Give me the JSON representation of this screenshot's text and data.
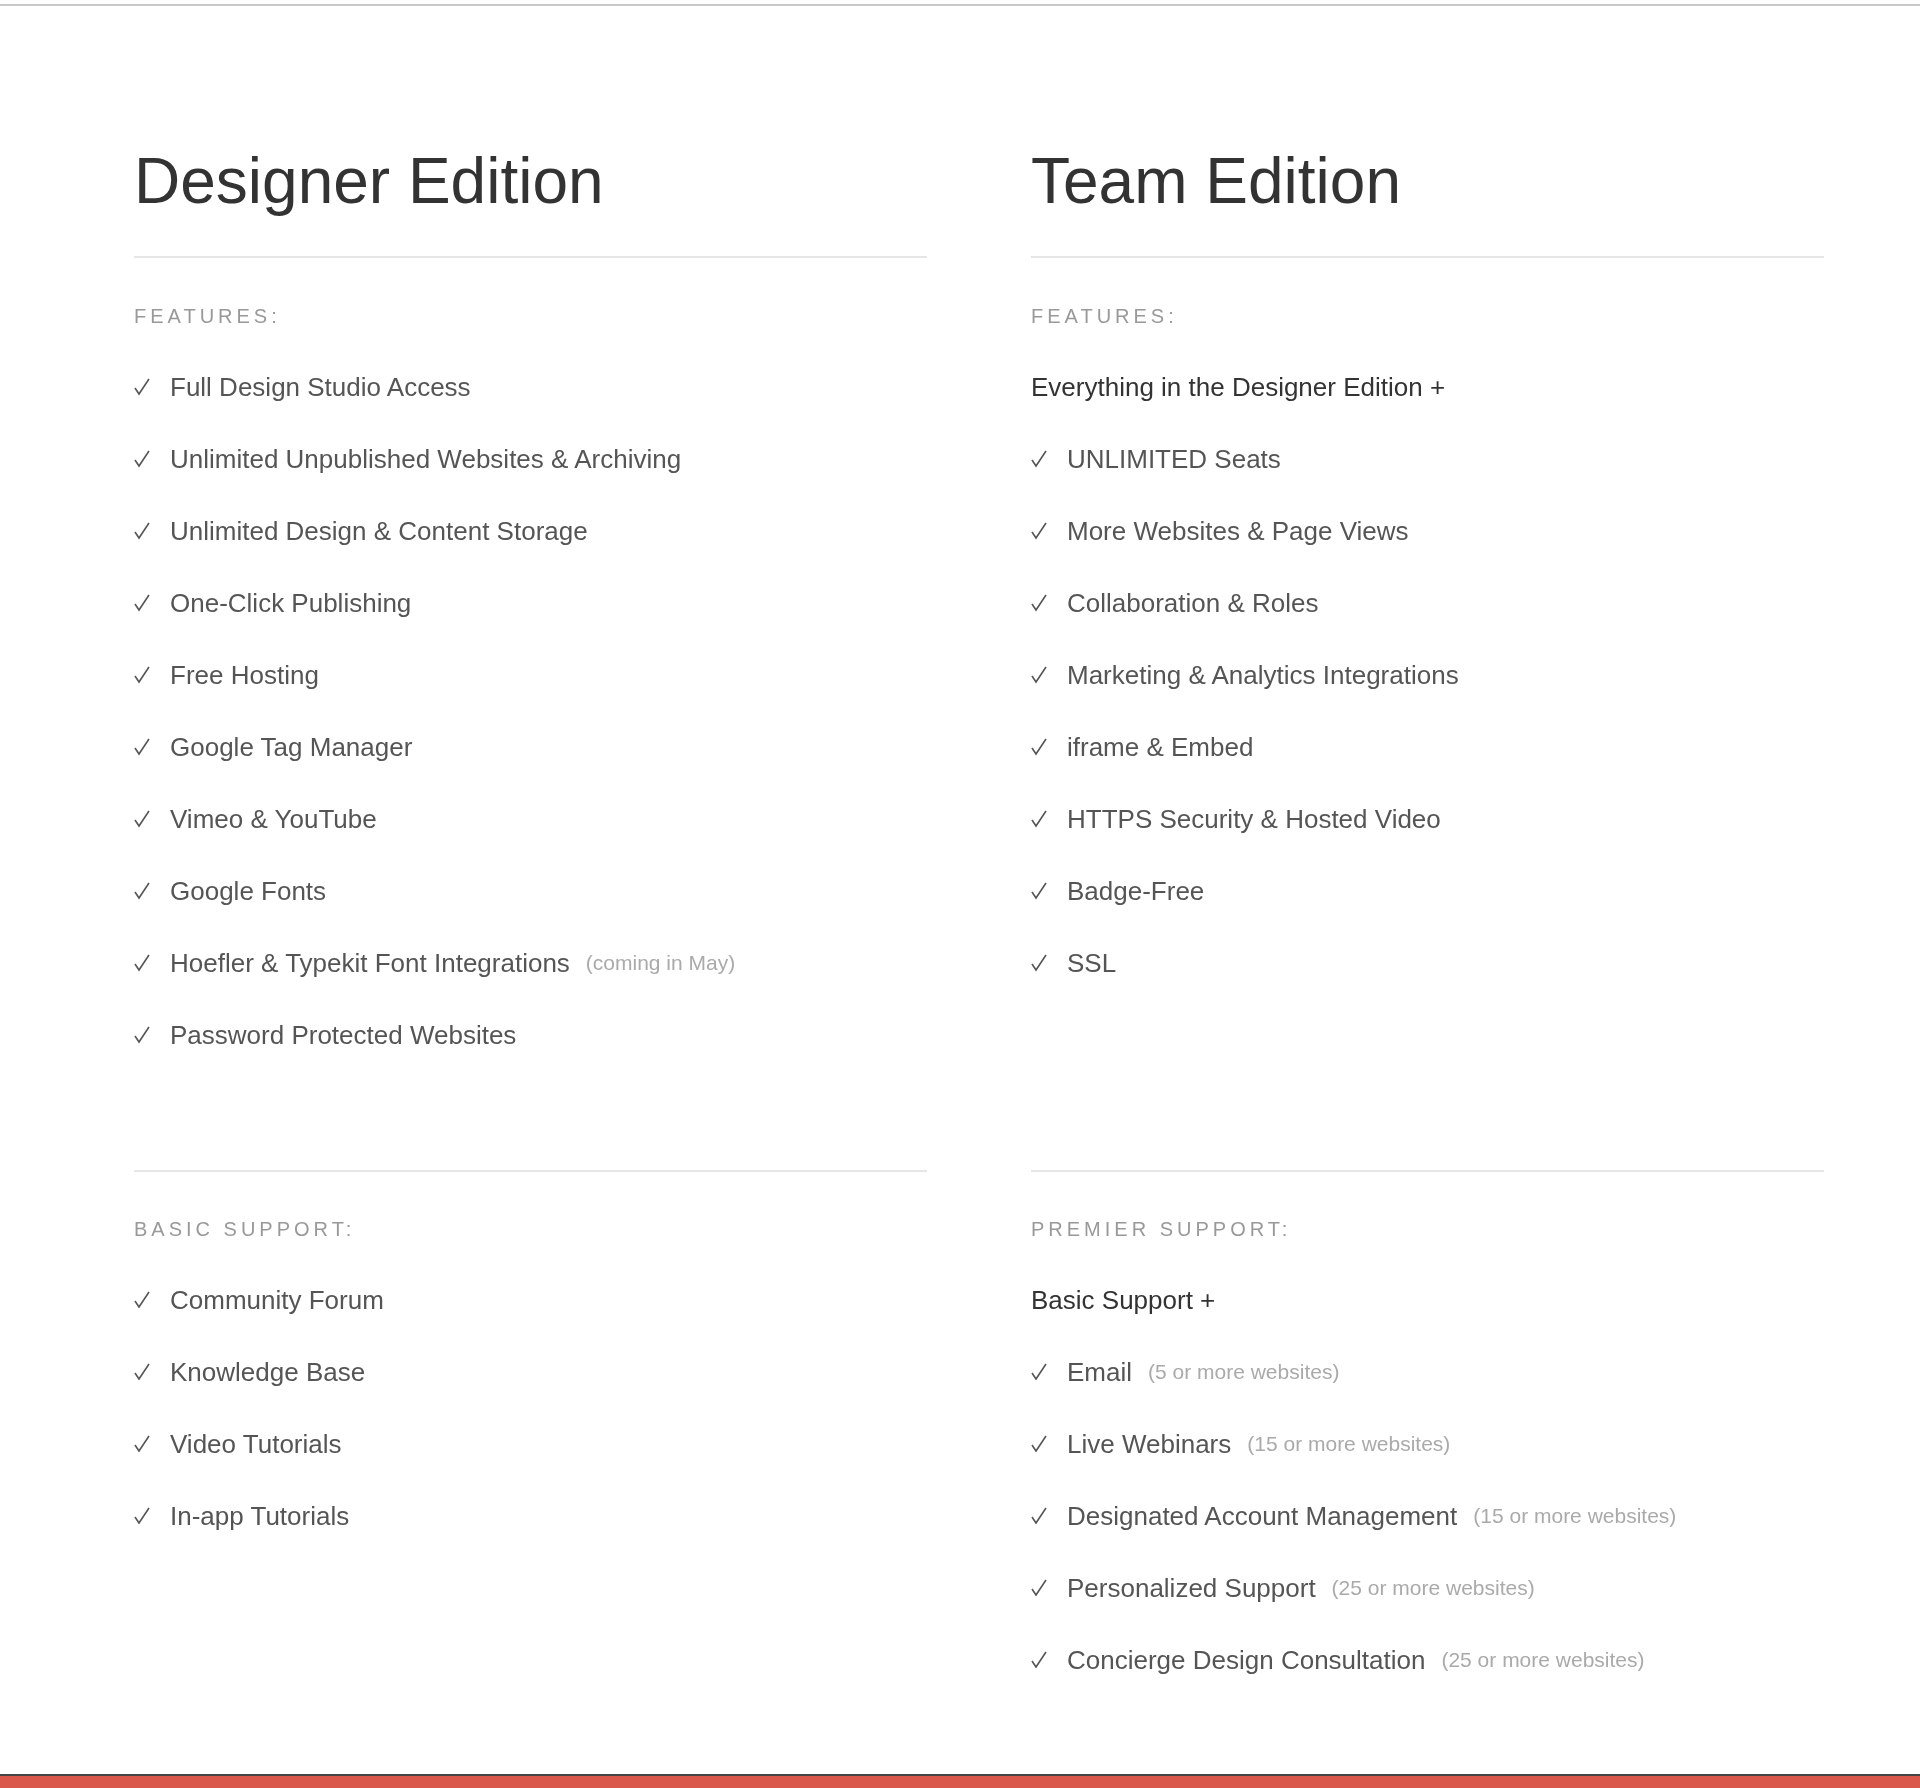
{
  "editions": [
    {
      "title": "Designer Edition",
      "features": {
        "heading": "FEATURES:",
        "items": [
          {
            "text": "Full Design Studio Access"
          },
          {
            "text": "Unlimited Unpublished Websites & Archiving"
          },
          {
            "text": "Unlimited Design & Content Storage"
          },
          {
            "text": "One-Click Publishing"
          },
          {
            "text": "Free Hosting"
          },
          {
            "text": "Google Tag Manager"
          },
          {
            "text": "Vimeo & YouTube"
          },
          {
            "text": "Google Fonts"
          },
          {
            "text": "Hoefler & Typekit Font Integrations",
            "note": "(coming in May)"
          },
          {
            "text": "Password Protected Websites"
          }
        ]
      },
      "support": {
        "heading": "BASIC SUPPORT:",
        "items": [
          {
            "text": "Community Forum"
          },
          {
            "text": "Knowledge  Base"
          },
          {
            "text": "Video Tutorials"
          },
          {
            "text": "In-app Tutorials"
          }
        ]
      }
    },
    {
      "title": "Team Edition",
      "features": {
        "heading": "FEATURES:",
        "intro": "Everything in the Designer Edition +",
        "items": [
          {
            "text": "UNLIMITED Seats"
          },
          {
            "text": "More Websites & Page Views"
          },
          {
            "text": "Collaboration & Roles"
          },
          {
            "text": "Marketing & Analytics Integrations"
          },
          {
            "text": "iframe & Embed"
          },
          {
            "text": "HTTPS Security & Hosted Video"
          },
          {
            "text": "Badge-Free"
          },
          {
            "text": "SSL"
          }
        ]
      },
      "support": {
        "heading": "PREMIER SUPPORT:",
        "intro": "Basic Support +",
        "items": [
          {
            "text": "Email",
            "note": "(5 or more websites)"
          },
          {
            "text": "Live Webinars",
            "note": "(15 or more websites)"
          },
          {
            "text": "Designated Account Management",
            "note": "(15 or more websites)"
          },
          {
            "text": "Personalized Support",
            "note": "(25 or more websites)"
          },
          {
            "text": "Concierge Design Consultation",
            "note": "(25 or more websites)"
          }
        ]
      }
    }
  ]
}
